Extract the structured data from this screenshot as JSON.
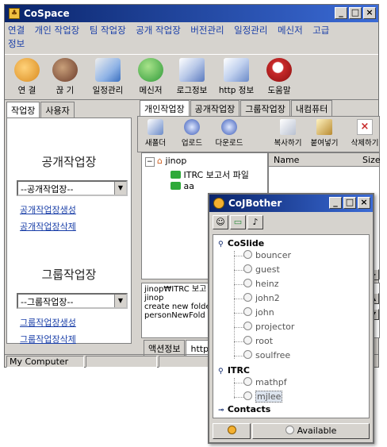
{
  "main_window": {
    "title": "CoSpace",
    "menu": [
      "연결",
      "개인 작업장",
      "팀 작업장",
      "공개 작업장",
      "버전관리",
      "일정관리",
      "메신저",
      "고급",
      "정보"
    ],
    "toolbar": [
      {
        "label": "연 결",
        "icon": "connect-icon",
        "color": "#d98a1e"
      },
      {
        "label": "끊 기",
        "icon": "disconnect-icon",
        "color": "#8a5a3a"
      },
      {
        "label": "일정관리",
        "icon": "schedule-icon",
        "color": "#3a6fbf"
      },
      {
        "label": "메신저",
        "icon": "messenger-icon",
        "color": "#2f9a3a"
      },
      {
        "label": "로그정보",
        "icon": "log-info-icon",
        "color": "#5a7abf"
      },
      {
        "label": "http 정보",
        "icon": "http-info-icon",
        "color": "#6a8ac8"
      },
      {
        "label": "도움말",
        "icon": "help-icon",
        "color": "#c82a2a"
      }
    ],
    "left_tabs": [
      "작업장",
      "사용자"
    ],
    "left_panel": {
      "public_heading": "공개작업장",
      "public_select": "--공개작업장--",
      "public_create": "공개작업장생성",
      "public_delete": "공개작업장삭제",
      "group_heading": "그룹작업장",
      "group_select": "--그룹작업장--",
      "group_create": "그룹작업장생성",
      "group_delete": "그룹작업장삭제"
    },
    "right_tabs": [
      "개인작업장",
      "공개작업장",
      "그룹작업장",
      "내컴퓨터"
    ],
    "file_toolbar": [
      "새폴더",
      "업로드",
      "다운로드",
      "복사하기",
      "붙여넣기",
      "삭제하기"
    ],
    "tree": {
      "root": "jinop",
      "children": [
        "ITRC 보고서 파일",
        "aa"
      ]
    },
    "list_columns": [
      "Name",
      "Size"
    ],
    "log_lines": [
      "jinop₩ITRC 보고",
      "jinop",
      "create new folde",
      "personNewFold"
    ],
    "bottom_tabs": [
      "액션정보",
      "http정"
    ],
    "status": "My Computer"
  },
  "chat_window": {
    "title": "CoJBother",
    "groups": [
      {
        "name": "CoSlide",
        "members": [
          "bouncer",
          "guest",
          "heinz",
          "john2",
          "john",
          "projector",
          "root",
          "soulfree"
        ]
      },
      {
        "name": "ITRC",
        "members": [
          "mathpf",
          "mjlee"
        ]
      },
      {
        "name": "Contacts",
        "members": []
      }
    ],
    "selected_member": "mjlee",
    "status_label": "Available"
  }
}
